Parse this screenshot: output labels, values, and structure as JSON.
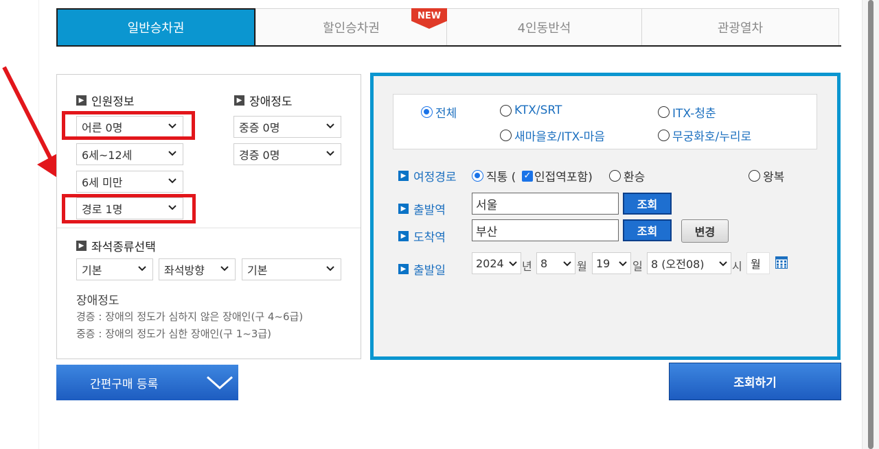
{
  "tabs": [
    {
      "label": "일반승차권",
      "active": true
    },
    {
      "label": "할인승차권",
      "active": false
    },
    {
      "label": "4인동반석",
      "active": false
    },
    {
      "label": "관광열차",
      "active": false
    }
  ],
  "new_badge": "NEW",
  "passenger": {
    "title": "인원정보",
    "adult": "어른 0명",
    "child": "6세~12세",
    "infant": "6세 미만",
    "senior": "경로 1명"
  },
  "disability": {
    "title": "장애정도",
    "severe": "중증 0명",
    "mild": "경증 0명"
  },
  "seat": {
    "title": "좌석종류선택",
    "type": "기본",
    "direction": "좌석방향",
    "option": "기본"
  },
  "note": {
    "title": "장애정도",
    "mild": "경증 : 장애의 정도가 심하지 않은 장애인(구 4~6급)",
    "severe": "중증 : 장애의 정도가 심한 장애인(구 1~3급)"
  },
  "train_types": {
    "all": "전체",
    "ktx": "KTX/SRT",
    "itx_cheongchun": "ITX-청춘",
    "saemaeul": "새마을호/ITX-마음",
    "mugunghwa": "무궁화호/누리로"
  },
  "route": {
    "label": "여정경로",
    "direct": "직통 (",
    "nearby": "인접역포함)",
    "transfer": "환승",
    "round_trip": "왕복"
  },
  "departure": {
    "label": "출발역",
    "value": "서울",
    "button": "조회"
  },
  "arrival": {
    "label": "도착역",
    "value": "부산",
    "button": "조회",
    "swap_button": "변경"
  },
  "date": {
    "label": "출발일",
    "year": "2024",
    "year_unit": "년",
    "month": "8",
    "month_unit": "월",
    "day": "19",
    "day_unit": "일",
    "hour": "8 (오전08)",
    "hour_unit": "시",
    "weekday": "월"
  },
  "bottom": {
    "quick_buy": "간편구매 등록",
    "search": "조회하기"
  },
  "colors": {
    "accent": "#0b96d0",
    "button_blue": "#1e6fd0",
    "highlight_red": "#e2161b"
  }
}
